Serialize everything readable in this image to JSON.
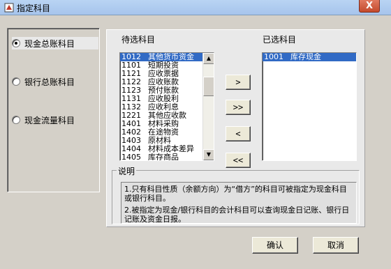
{
  "window": {
    "title": "指定科目",
    "close_label": "X"
  },
  "options": [
    {
      "label": "现金总账科目",
      "checked": true
    },
    {
      "label": "银行总账科目",
      "checked": false
    },
    {
      "label": "现金流量科目",
      "checked": false
    }
  ],
  "candidates": {
    "title": "待选科目",
    "items": [
      {
        "code": "1012",
        "name": "其他货币资金"
      },
      {
        "code": "1101",
        "name": "短期投资"
      },
      {
        "code": "1121",
        "name": "应收票据"
      },
      {
        "code": "1122",
        "name": "应收账款"
      },
      {
        "code": "1123",
        "name": "预付账款"
      },
      {
        "code": "1131",
        "name": "应收股利"
      },
      {
        "code": "1132",
        "name": "应收利息"
      },
      {
        "code": "1221",
        "name": "其他应收款"
      },
      {
        "code": "1401",
        "name": "材料采购"
      },
      {
        "code": "1402",
        "name": "在途物资"
      },
      {
        "code": "1403",
        "name": "原材料"
      },
      {
        "code": "1404",
        "name": "材料成本差异"
      },
      {
        "code": "1405",
        "name": "库存商品"
      }
    ]
  },
  "selected": {
    "title": "已选科目",
    "items": [
      {
        "code": "1001",
        "name": "库存现金"
      }
    ]
  },
  "transfer": {
    "add": ">",
    "add_all": ">>",
    "remove": "<",
    "remove_all": "<<"
  },
  "notes": {
    "title": "说明",
    "line1": "1.只有科目性质（余额方向）为“借方”的科目可被指定为现金科目或银行科目。",
    "line2": "2.被指定为现金/银行科目的会计科目可以查询现金日记账、银行日记账及资金日报。"
  },
  "buttons": {
    "ok": "确认",
    "cancel": "取消"
  }
}
